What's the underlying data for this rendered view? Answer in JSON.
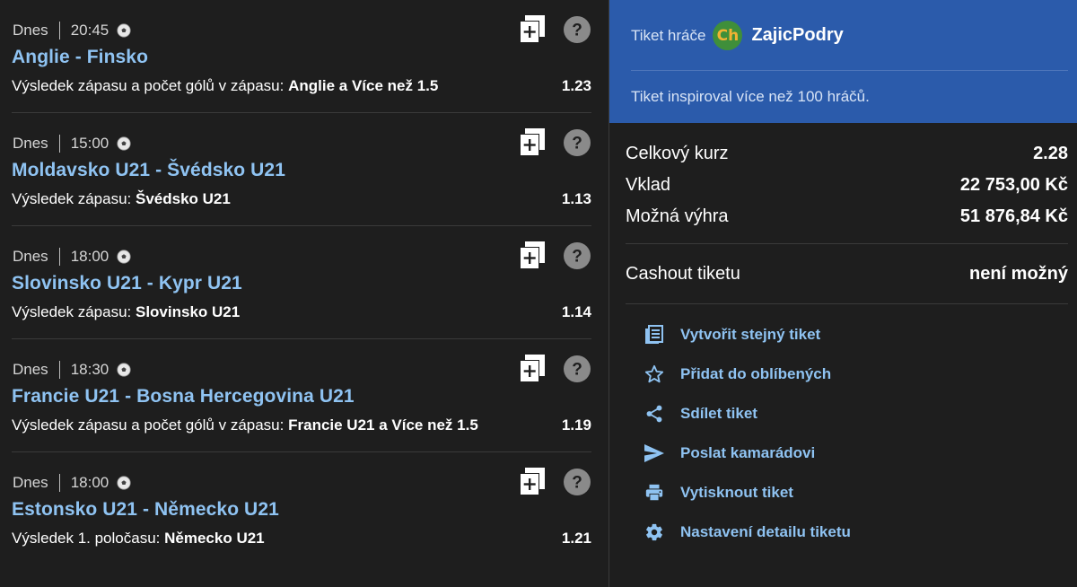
{
  "matches": [
    {
      "day": "Dnes",
      "time": "20:45",
      "teams": "Anglie - Finsko",
      "market": "Výsledek zápasu a počet gólů v zápasu:",
      "selection": "Anglie a Více než 1.5",
      "odds": "1.23"
    },
    {
      "day": "Dnes",
      "time": "15:00",
      "teams": "Moldavsko U21 - Švédsko U21",
      "market": "Výsledek zápasu:",
      "selection": "Švédsko U21",
      "odds": "1.13"
    },
    {
      "day": "Dnes",
      "time": "18:00",
      "teams": "Slovinsko U21 - Kypr U21",
      "market": "Výsledek zápasu:",
      "selection": "Slovinsko U21",
      "odds": "1.14"
    },
    {
      "day": "Dnes",
      "time": "18:30",
      "teams": "Francie U21 - Bosna Hercegovina U21",
      "market": "Výsledek zápasu a počet gólů v zápasu:",
      "selection": "Francie U21 a Více než 1.5",
      "odds": "1.19"
    },
    {
      "day": "Dnes",
      "time": "18:00",
      "teams": "Estonsko U21 - Německo U21",
      "market": "Výsledek 1. poločasu:",
      "selection": "Německo U21",
      "odds": "1.21"
    }
  ],
  "ticket": {
    "label": "Tiket hráče",
    "logo_text": "Ch",
    "username": "ZajicPodry",
    "inspired": "Tiket inspiroval více než 100 hráčů."
  },
  "stats": {
    "total_odds_label": "Celkový kurz",
    "total_odds_value": "2.28",
    "stake_label": "Vklad",
    "stake_value": "22 753,00 Kč",
    "win_label": "Možná výhra",
    "win_value": "51 876,84 Kč",
    "cashout_label": "Cashout tiketu",
    "cashout_value": "není možný"
  },
  "actions": [
    {
      "icon": "copy-ticket-icon",
      "label": "Vytvořit stejný tiket"
    },
    {
      "icon": "star-icon",
      "label": "Přidat do oblíbených"
    },
    {
      "icon": "share-icon",
      "label": "Sdílet tiket"
    },
    {
      "icon": "send-icon",
      "label": "Poslat kamarádovi"
    },
    {
      "icon": "print-icon",
      "label": "Vytisknout tiket"
    },
    {
      "icon": "settings-icon",
      "label": "Nastavení detailu tiketu"
    }
  ],
  "colors": {
    "accent": "#8fc3f2",
    "header_bg": "#2b5bab",
    "background": "#1e1e1e"
  }
}
